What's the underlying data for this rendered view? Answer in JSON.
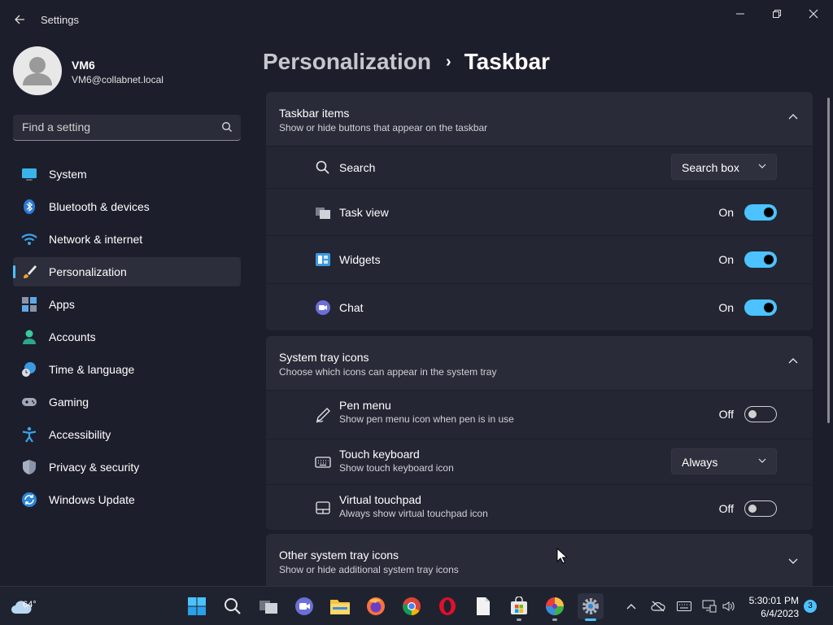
{
  "app": {
    "title": "Settings"
  },
  "user": {
    "name": "VM6",
    "email": "VM6@collabnet.local"
  },
  "search": {
    "placeholder": "Find a setting"
  },
  "nav": {
    "items": [
      {
        "label": "System",
        "icon": "monitor-icon"
      },
      {
        "label": "Bluetooth & devices",
        "icon": "bluetooth-icon"
      },
      {
        "label": "Network & internet",
        "icon": "wifi-icon"
      },
      {
        "label": "Personalization",
        "icon": "paintbrush-icon",
        "active": true
      },
      {
        "label": "Apps",
        "icon": "apps-icon"
      },
      {
        "label": "Accounts",
        "icon": "person-icon"
      },
      {
        "label": "Time & language",
        "icon": "globe-clock-icon"
      },
      {
        "label": "Gaming",
        "icon": "gamepad-icon"
      },
      {
        "label": "Accessibility",
        "icon": "accessibility-icon"
      },
      {
        "label": "Privacy & security",
        "icon": "shield-icon"
      },
      {
        "label": "Windows Update",
        "icon": "update-icon"
      }
    ]
  },
  "breadcrumb": {
    "parent": "Personalization",
    "separator": "›",
    "current": "Taskbar"
  },
  "taskbar_items": {
    "title": "Taskbar items",
    "subtitle": "Show or hide buttons that appear on the taskbar",
    "search": {
      "label": "Search",
      "value": "Search box"
    },
    "task_view": {
      "label": "Task view",
      "state": "On"
    },
    "widgets": {
      "label": "Widgets",
      "state": "On"
    },
    "chat": {
      "label": "Chat",
      "state": "On"
    }
  },
  "system_tray": {
    "title": "System tray icons",
    "subtitle": "Choose which icons can appear in the system tray",
    "pen_menu": {
      "label": "Pen menu",
      "description": "Show pen menu icon when pen is in use",
      "state": "Off"
    },
    "touch_keyboard": {
      "label": "Touch keyboard",
      "description": "Show touch keyboard icon",
      "value": "Always"
    },
    "virtual_touchpad": {
      "label": "Virtual touchpad",
      "description": "Always show virtual touchpad icon",
      "state": "Off"
    }
  },
  "other_tray": {
    "title": "Other system tray icons",
    "subtitle": "Show or hide additional system tray icons"
  },
  "taskbar": {
    "weather_temp": "64°",
    "time": "5:30:01 PM",
    "date": "6/4/2023",
    "notification_count": "3"
  },
  "colors": {
    "accent": "#4cc2ff",
    "background": "#1d1e2b",
    "card": "#272835"
  }
}
